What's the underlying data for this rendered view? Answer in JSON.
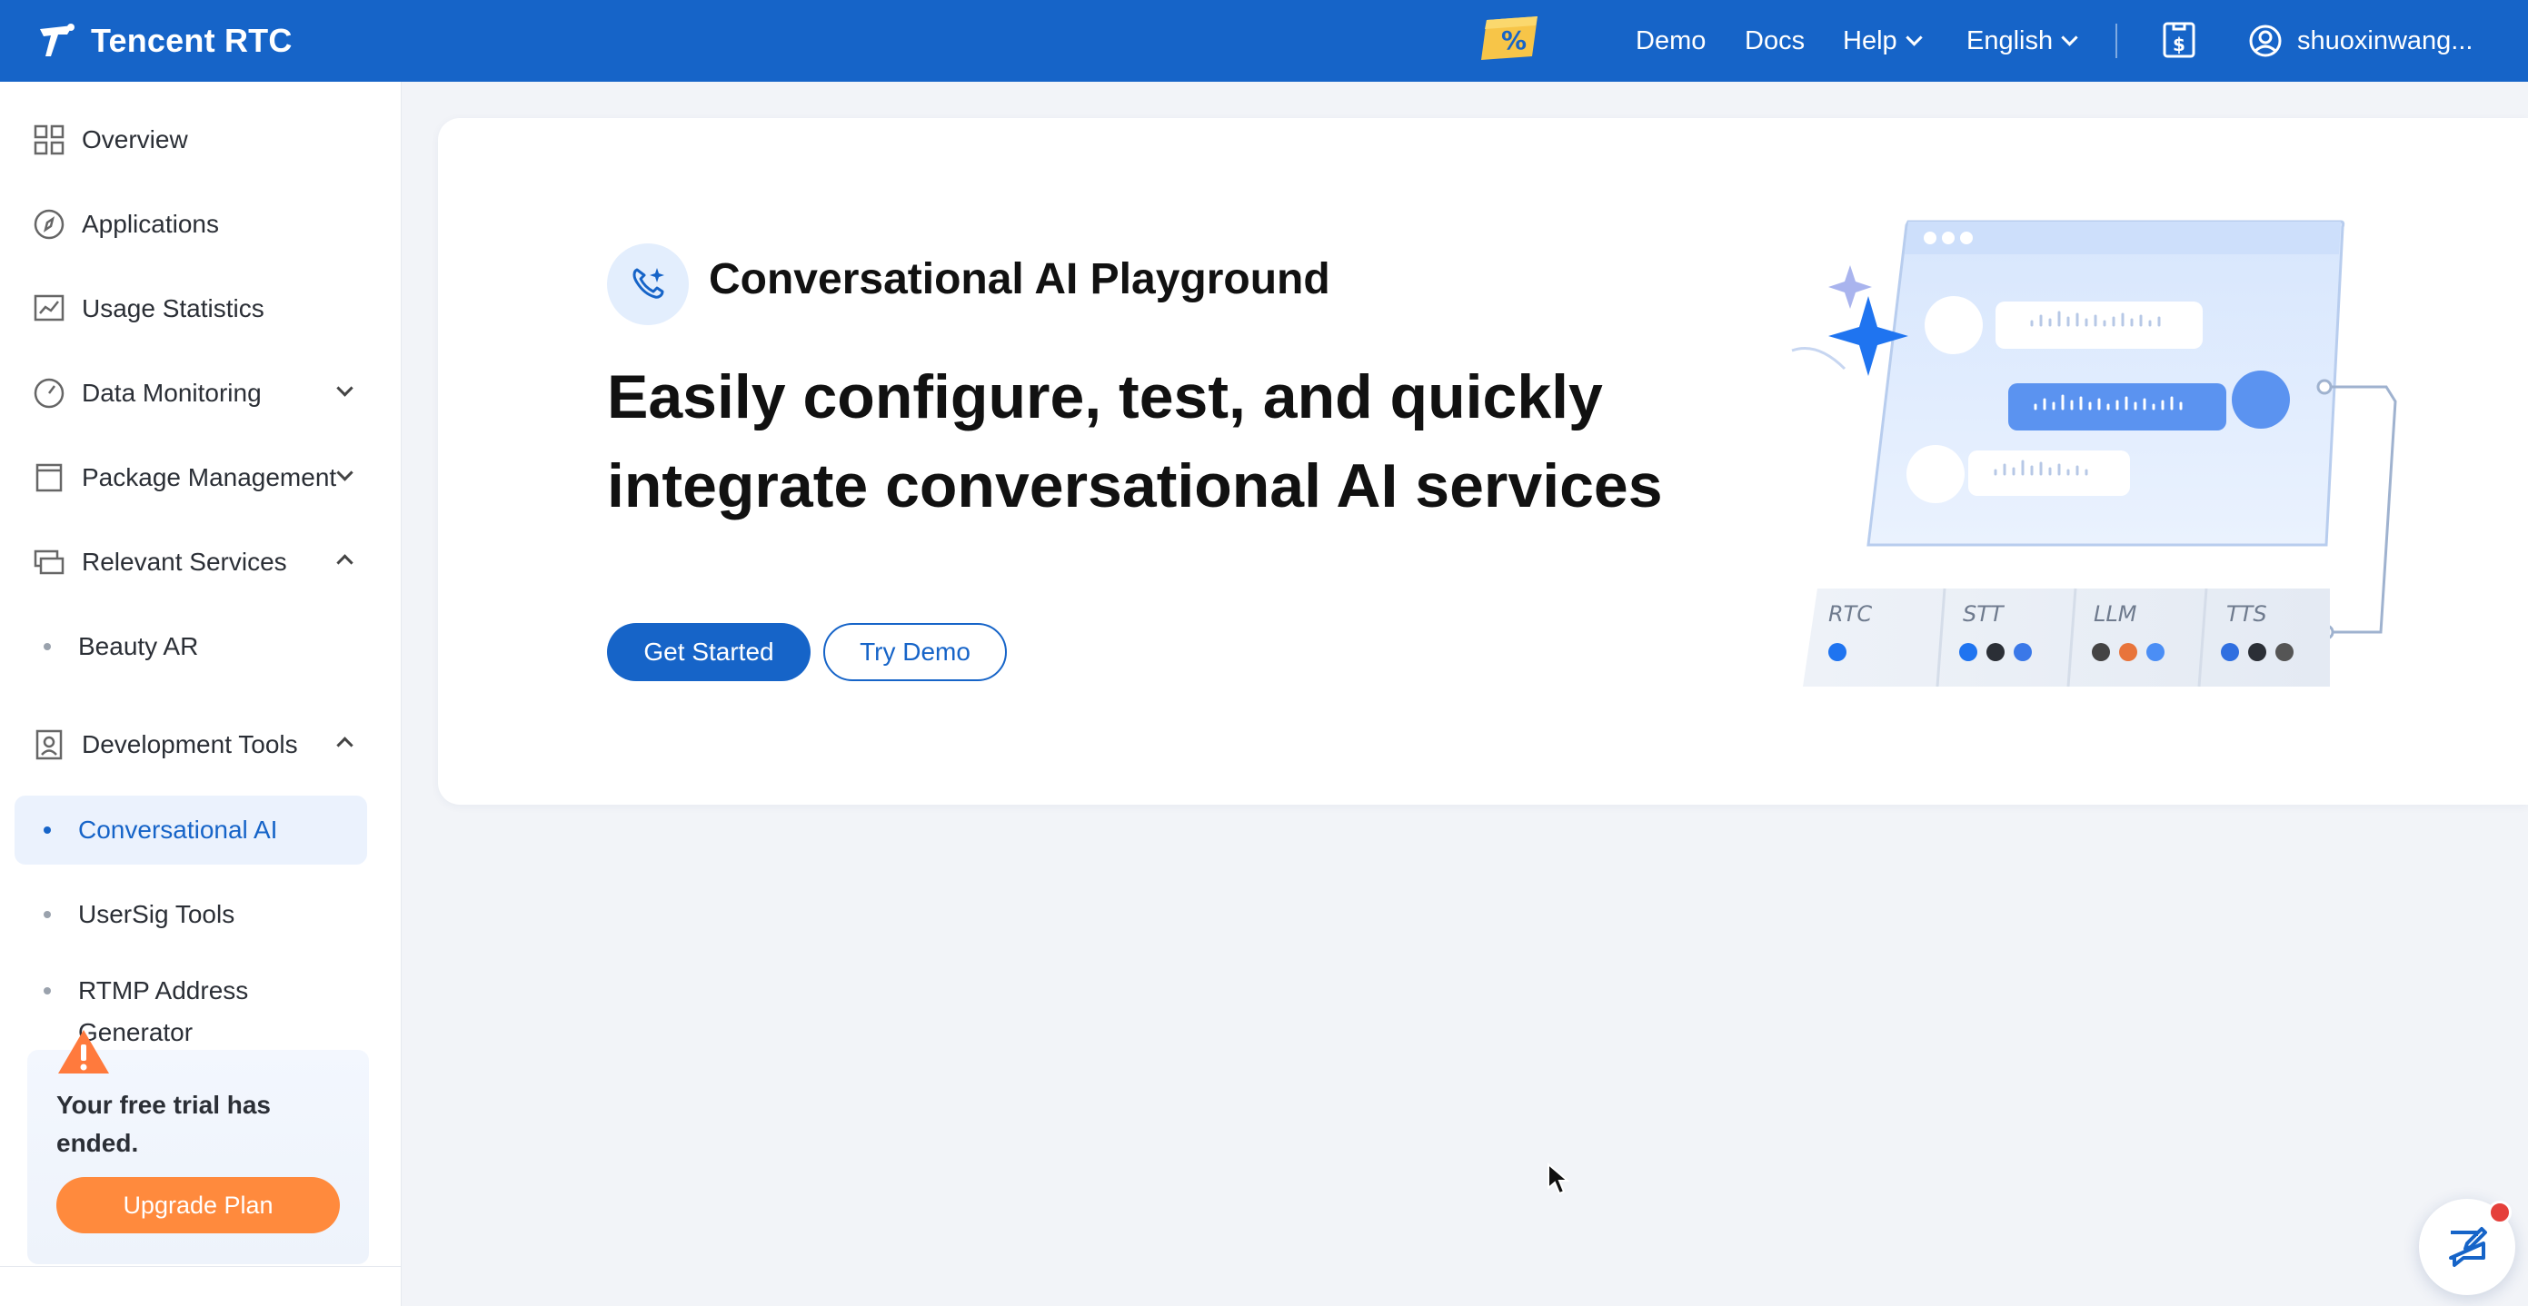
{
  "header": {
    "brand": "Tencent RTC",
    "promo_icon": "discount-coupon-icon",
    "nav": {
      "demo": "Demo",
      "docs": "Docs",
      "help": "Help",
      "language": "English"
    },
    "billing_icon": "billing-icon",
    "username": "shuoxinwang..."
  },
  "sidebar": {
    "items": [
      {
        "label": "Overview",
        "icon": "grid-icon"
      },
      {
        "label": "Applications",
        "icon": "compass-icon"
      },
      {
        "label": "Usage Statistics",
        "icon": "chart-icon"
      },
      {
        "label": "Data Monitoring",
        "icon": "gauge-icon"
      },
      {
        "label": "Package Management",
        "icon": "package-icon"
      },
      {
        "label": "Relevant Services",
        "icon": "services-icon"
      },
      {
        "label": "Development Tools",
        "icon": "tools-icon"
      }
    ],
    "sub_items": [
      {
        "label": "Beauty AR"
      },
      {
        "label": "Conversational AI"
      },
      {
        "label": "UserSig Tools"
      },
      {
        "label": "RTMP Address Generator"
      }
    ],
    "trial": {
      "message": "Your free trial has ended.",
      "button": "Upgrade Plan"
    }
  },
  "main": {
    "playground_title": "Conversational AI Playground",
    "headline": "Easily configure, test, and quickly integrate conversational AI services",
    "buttons": {
      "get_started": "Get Started",
      "try_demo": "Try Demo"
    },
    "illustration": {
      "labels": [
        "RTC",
        "STT",
        "LLM",
        "TTS"
      ]
    }
  },
  "colors": {
    "primary": "#1664c8",
    "orange": "#ff8a3d",
    "background": "#f2f4f8"
  }
}
